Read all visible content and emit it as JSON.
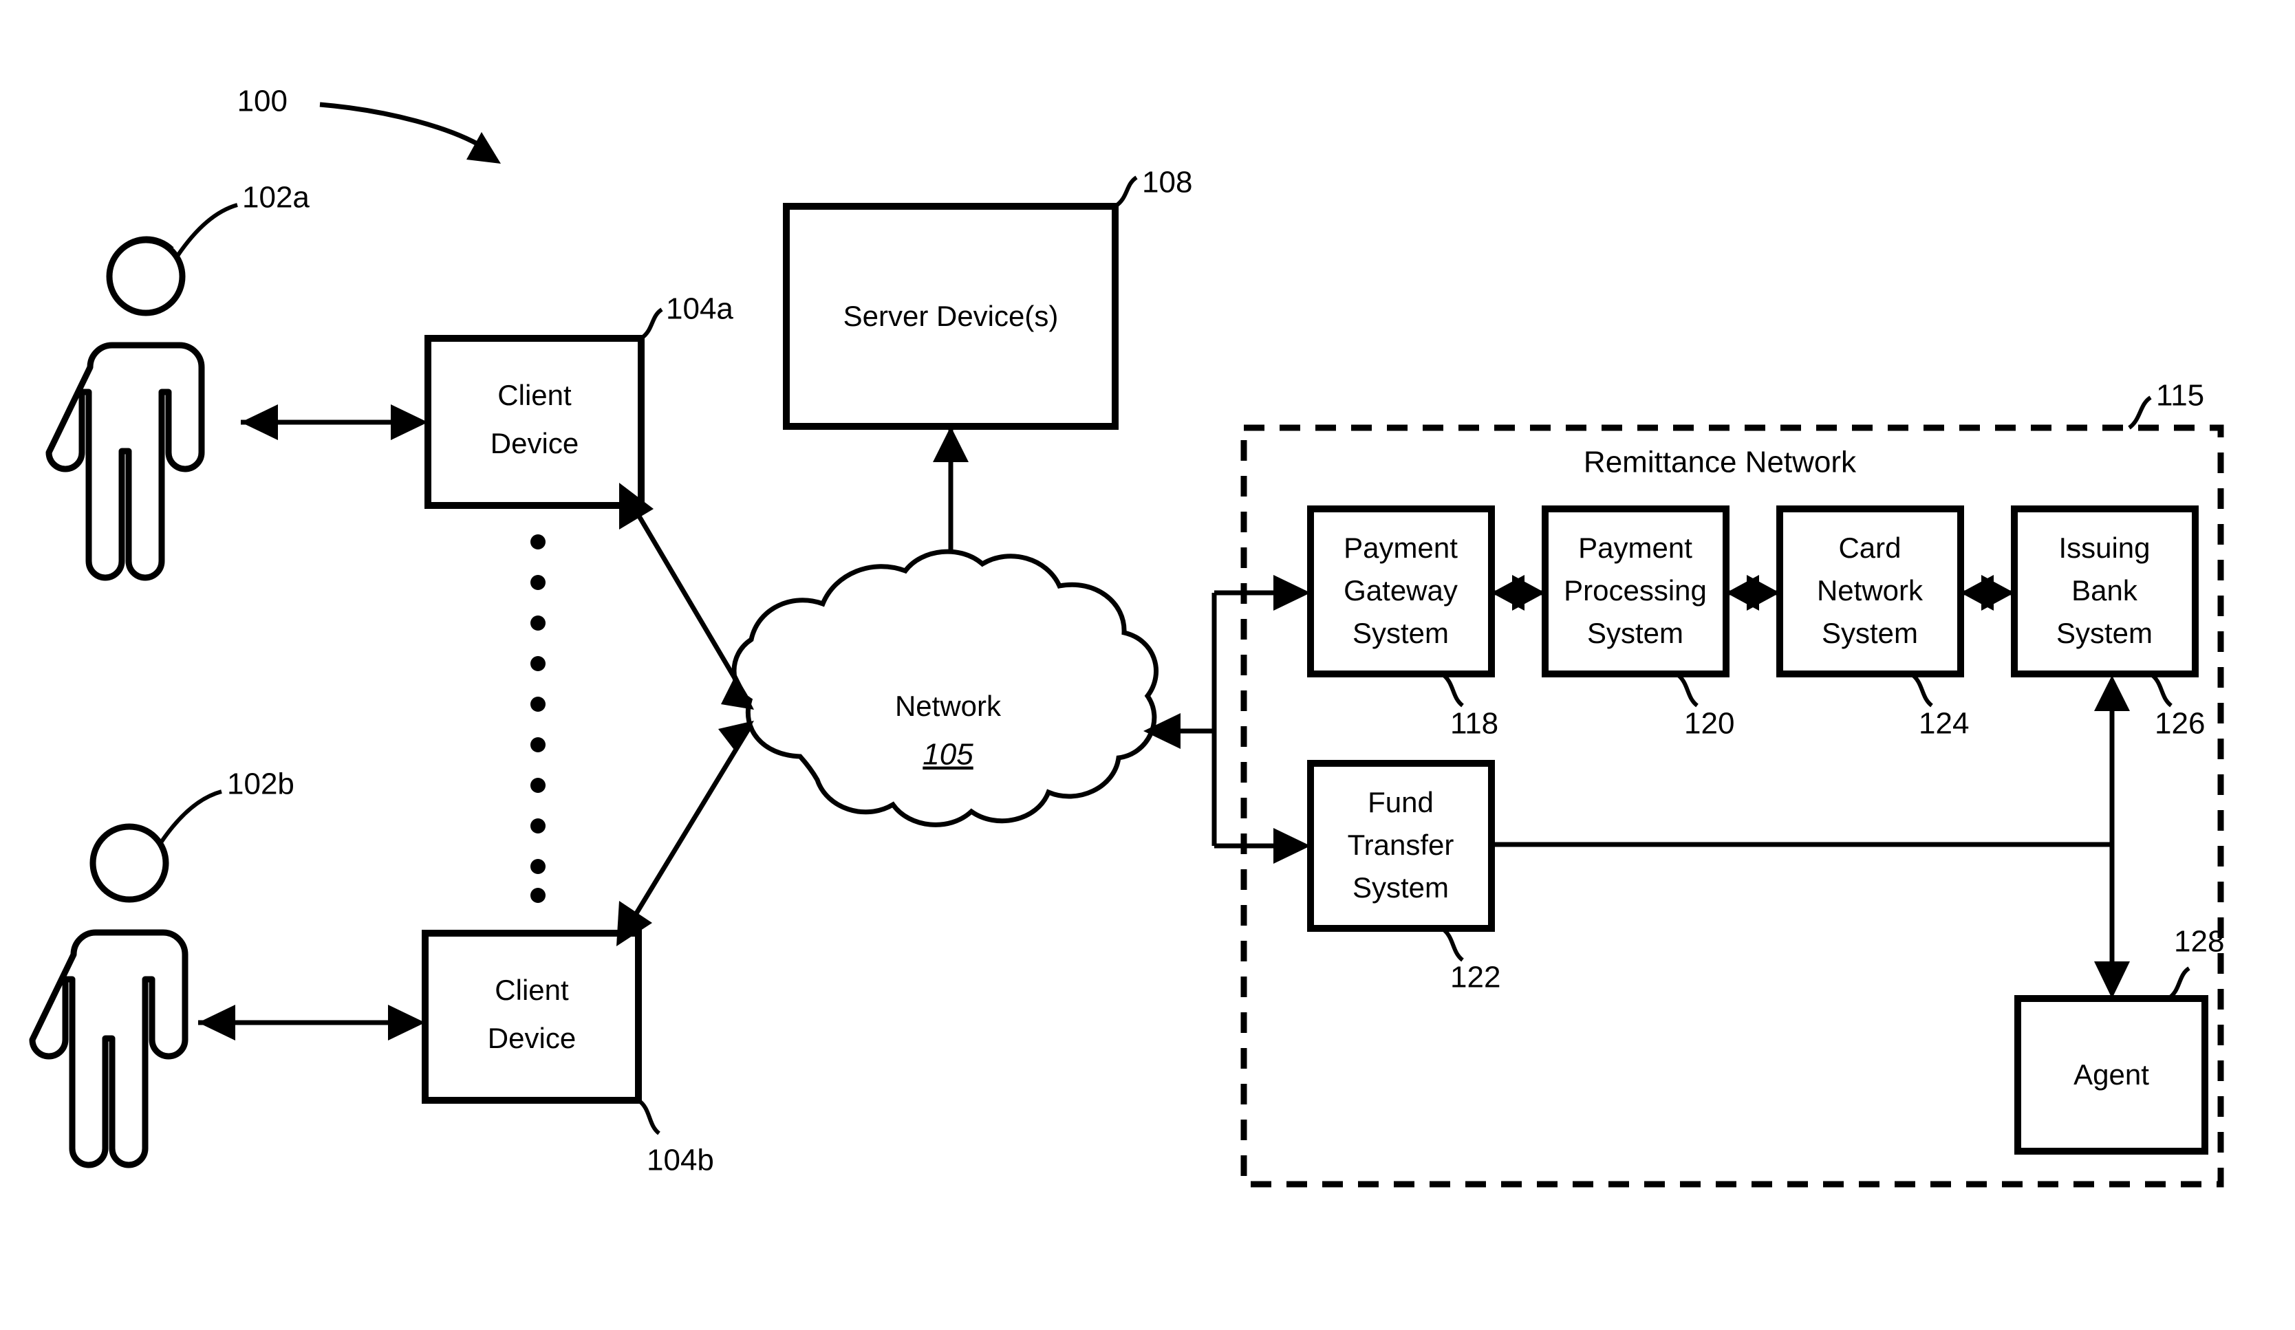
{
  "figure": {
    "figure_ref": "100",
    "boundary_label": "Remittance Network",
    "boundary_ref": "115"
  },
  "actors": [
    {
      "name": "user-a",
      "ref": "102a"
    },
    {
      "name": "user-b",
      "ref": "102b"
    }
  ],
  "client_devices": [
    {
      "label_line1": "Client",
      "label_line2": "Device",
      "ref": "104a"
    },
    {
      "label_line1": "Client",
      "label_line2": "Device",
      "ref": "104b"
    }
  ],
  "server": {
    "label": "Server Device(s)",
    "ref": "108"
  },
  "network": {
    "label": "Network",
    "ref": "105"
  },
  "remittance_systems": [
    {
      "line1": "Payment",
      "line2": "Gateway",
      "line3": "System",
      "ref": "118"
    },
    {
      "line1": "Payment",
      "line2": "Processing",
      "line3": "System",
      "ref": "120"
    },
    {
      "line1": "Card",
      "line2": "Network",
      "line3": "System",
      "ref": "124"
    },
    {
      "line1": "Issuing",
      "line2": "Bank",
      "line3": "System",
      "ref": "126"
    }
  ],
  "fund_transfer": {
    "line1": "Fund",
    "line2": "Transfer",
    "line3": "System",
    "ref": "122"
  },
  "agent": {
    "label": "Agent",
    "ref": "128"
  },
  "colors": {
    "ink": "#000000",
    "paper": "#ffffff"
  }
}
